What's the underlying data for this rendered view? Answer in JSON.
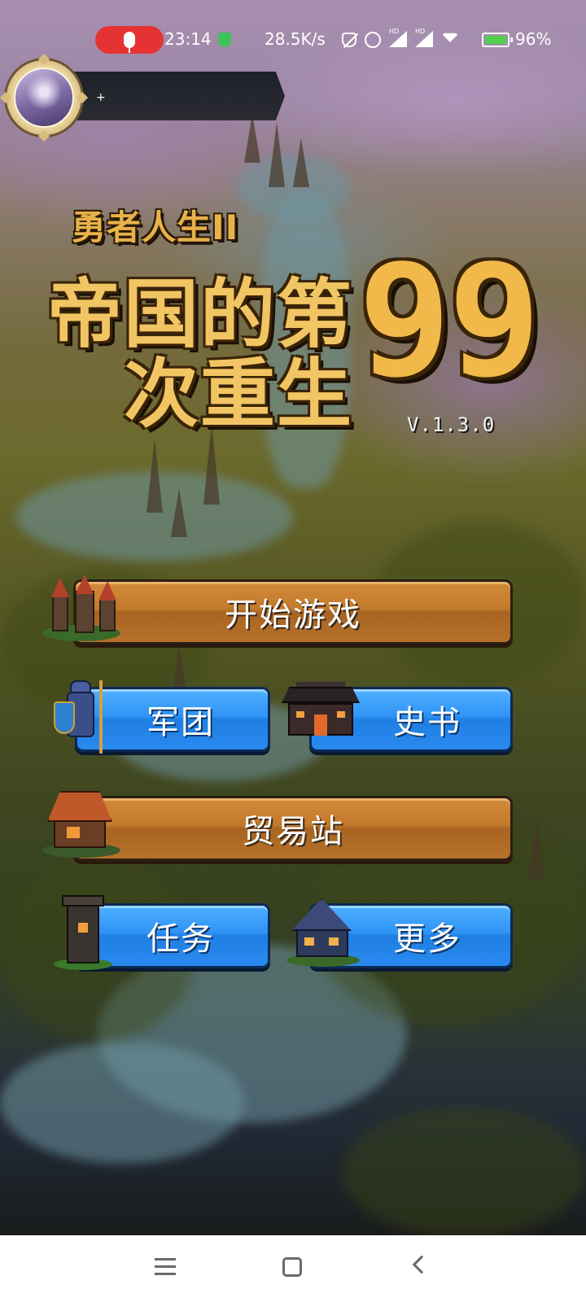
{
  "status_bar": {
    "time": "23:14",
    "net_speed": "28.5K/s",
    "signal_1_label": "HD",
    "signal_2_label": "HD",
    "battery_percent": "96%",
    "battery_level": 0.96,
    "recording": true
  },
  "player": {
    "name": "+"
  },
  "title": {
    "subtitle": "勇者人生II",
    "line1": "帝国的第",
    "line2": "次重生",
    "number": "99",
    "version": "V.1.3.0"
  },
  "menu": {
    "start_game": "开始游戏",
    "legion": "军团",
    "history_book": "史书",
    "trading_post": "贸易站",
    "quests": "任务",
    "more": "更多"
  },
  "colors": {
    "brown_button": "#c37a2c",
    "blue_button": "#2f93f6",
    "title_gold": "#f2c564",
    "record_red": "#e53333"
  },
  "icons": {
    "start_game": "castle-icon",
    "legion": "knight-icon",
    "history_book": "hall-icon",
    "trading_post": "shop-icon",
    "quests": "tower-icon",
    "more": "house-icon"
  }
}
